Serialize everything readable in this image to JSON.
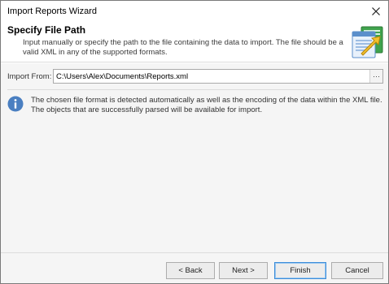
{
  "window": {
    "title": "Import Reports Wizard"
  },
  "header": {
    "title": "Specify File Path",
    "description": "Input manually or specify the path to the file containing the data to import. The file should be a valid XML in any of the supported formats."
  },
  "path": {
    "label": "Import From:",
    "value": "C:\\Users\\Alex\\Documents\\Reports.xml",
    "browse_label": "···"
  },
  "info": {
    "text": "The chosen file format is detected automatically as well as the encoding of the data within the XML file. The objects that are successfully parsed will be available for import."
  },
  "buttons": {
    "back": "< Back",
    "next": "Next >",
    "finish": "Finish",
    "cancel": "Cancel"
  },
  "colors": {
    "accent": "#3c8dd9",
    "info_icon": "#4a7fc1",
    "footer_bg": "#f5f5f5"
  },
  "icons": {
    "close": "close-icon",
    "header": "report-import-icon",
    "info": "info-icon"
  }
}
